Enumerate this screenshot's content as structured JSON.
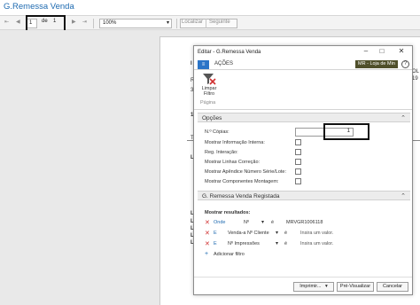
{
  "page": {
    "title": "G.Remessa Venda"
  },
  "toolbar": {
    "first_page": "⇤",
    "prev_page": "◀",
    "current_page": "1",
    "of_label": "de",
    "total_pages": "1",
    "next_page": "▶",
    "last_page": "⇥",
    "zoom": "100%",
    "find_label": "Localizar",
    "next_label": "Seguinte"
  },
  "report_fragments": [
    "I",
    "R",
    "3",
    "OL",
    "19",
    "1",
    "T",
    "L",
    "Le",
    "Lc",
    "Lc",
    "Lc",
    "Lc"
  ],
  "dialog": {
    "title": "Editar - G.Remessa Venda",
    "menu_button": "≡",
    "tab_label": "AÇÕES",
    "company": "MR - Loja de Min",
    "ribbon_action": "Limpar Filtro",
    "ribbon_group": "Página",
    "options_title": "Opções",
    "options": [
      {
        "label": "N.º Cópias:",
        "type": "number",
        "value": "1"
      },
      {
        "label": "Mostrar Informação Interna:",
        "type": "checkbox"
      },
      {
        "label": "Reg. Interação:",
        "type": "checkbox"
      },
      {
        "label": "Mostrar Linhas Correção:",
        "type": "checkbox"
      },
      {
        "label": "Mostrar Apêndice Número Série/Lote:",
        "type": "checkbox"
      },
      {
        "label": "Mostrar Componentes Montagem:",
        "type": "checkbox"
      }
    ],
    "registered_title": "G. Remessa Venda Registada",
    "show_results_label": "Mostrar resultados:",
    "filters": [
      {
        "connector": "Onde",
        "field": "Nº",
        "op": "é",
        "value": "MRVGR1006118"
      },
      {
        "connector": "E",
        "field": "Venda-a Nº Cliente",
        "op": "é",
        "value": "Insira um valor."
      },
      {
        "connector": "E",
        "field": "Nº Impressões",
        "op": "é",
        "value": "Insira um valor."
      }
    ],
    "add_filter": "Adicionar filtro",
    "print_button": "Imprimir...",
    "preview_button": "Pré-Visualizar",
    "cancel_button": "Cancelar"
  }
}
